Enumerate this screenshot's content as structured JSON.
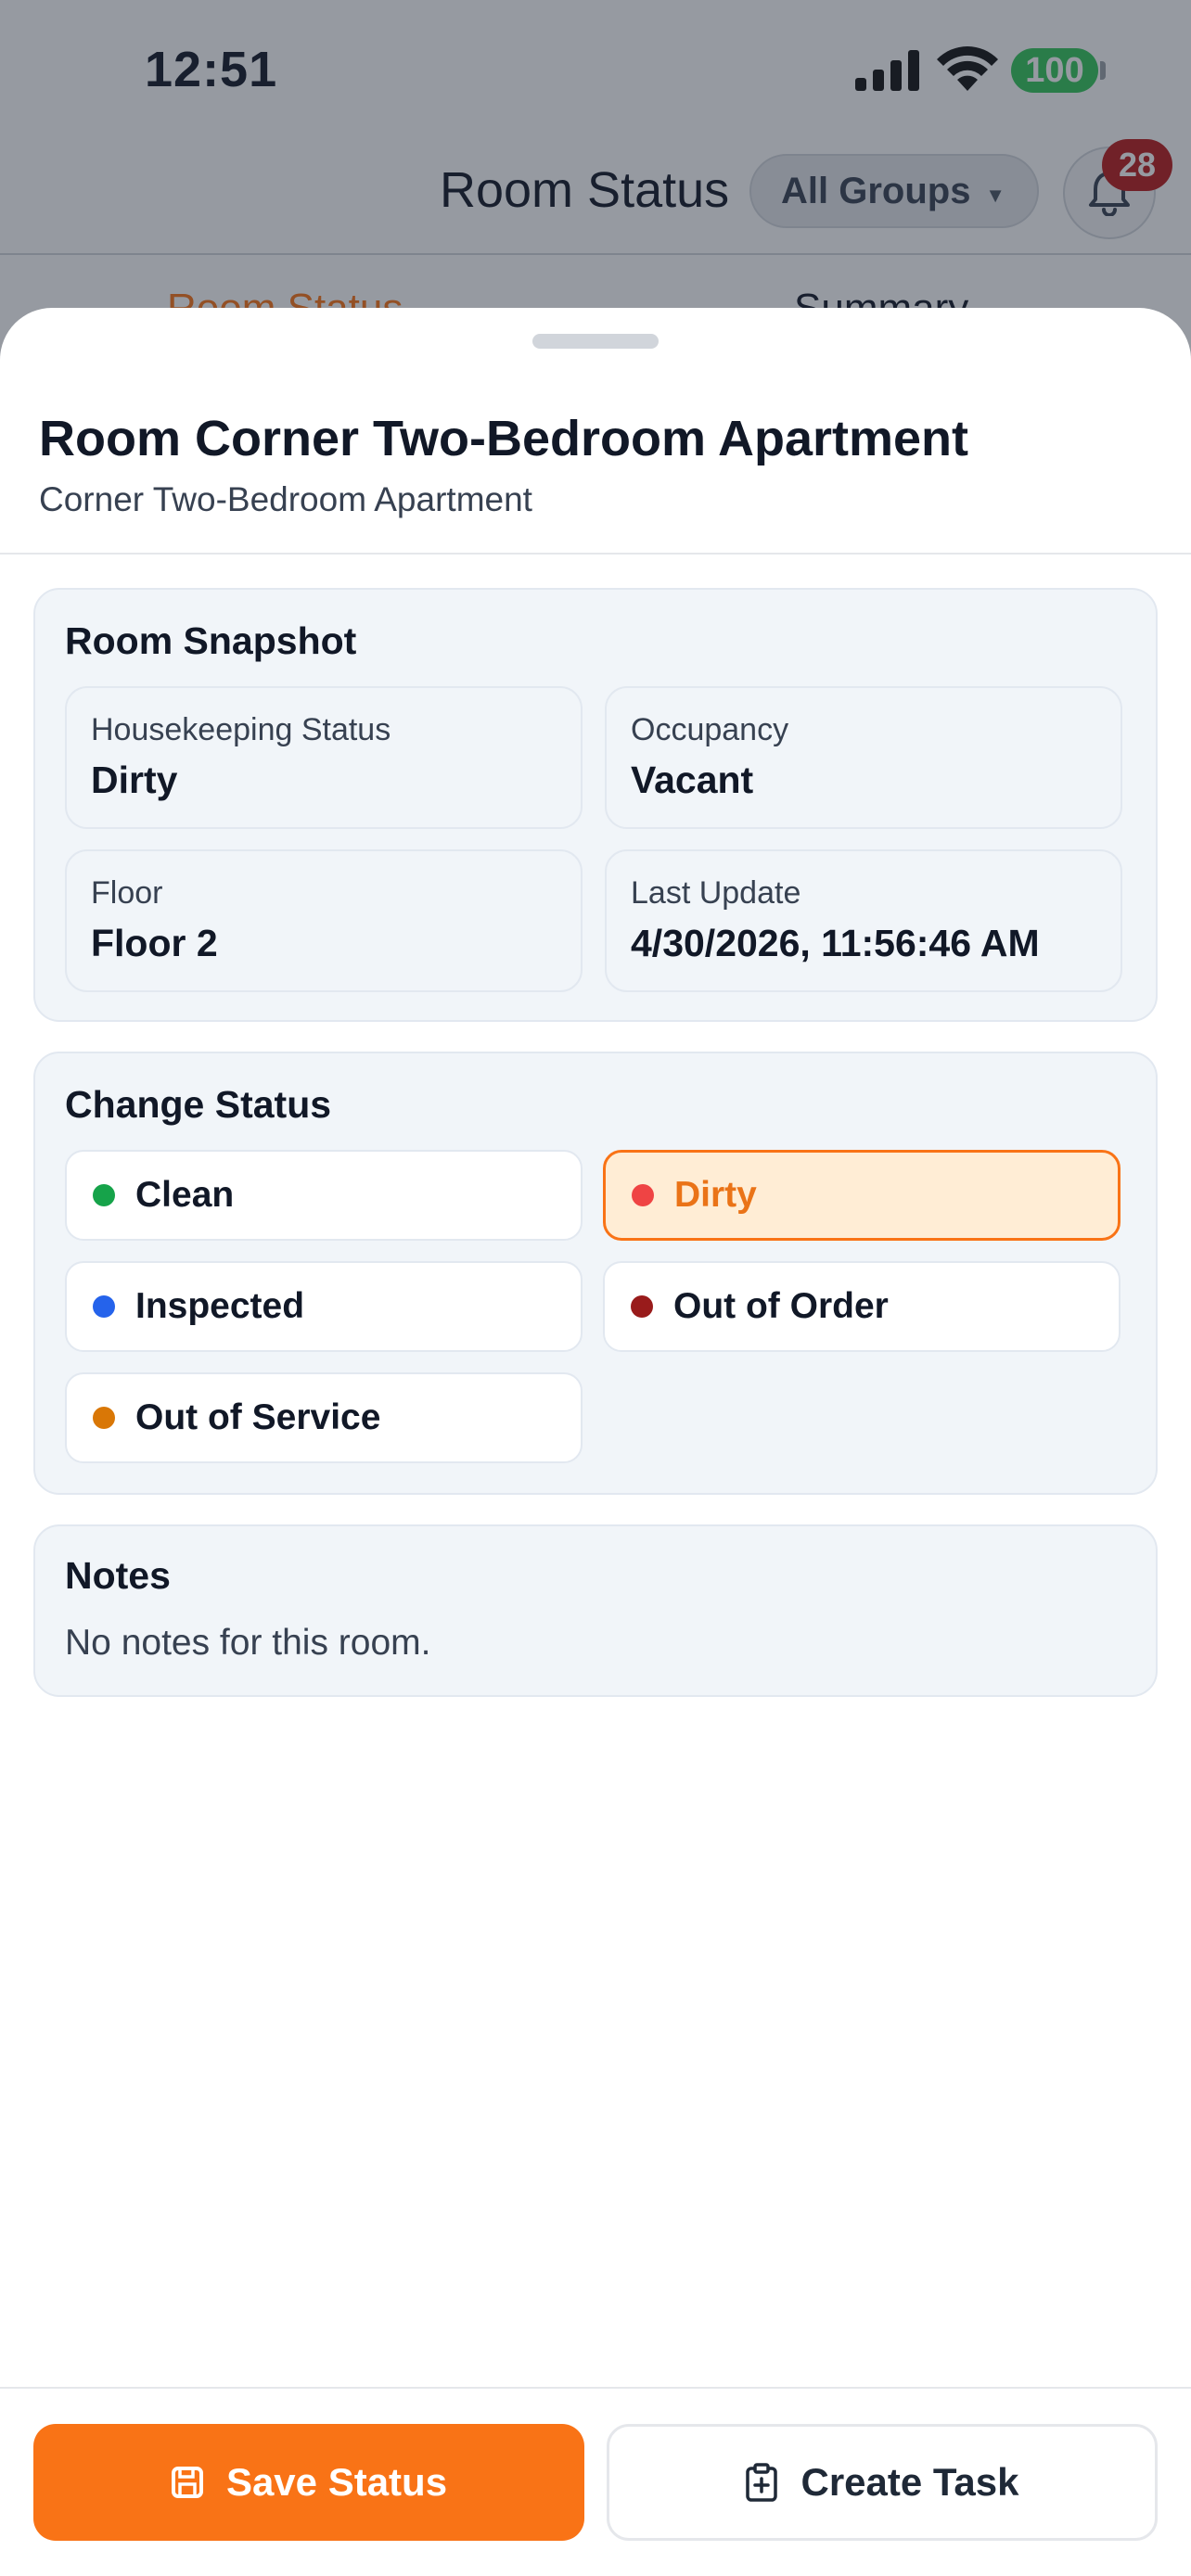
{
  "status_bar": {
    "time": "12:51",
    "battery": "100",
    "icons": [
      "cellular-signal-icon",
      "wifi-icon",
      "battery-icon"
    ]
  },
  "header": {
    "title": "Room Status",
    "group_filter": "All Groups",
    "notification_count": "28",
    "icons": [
      "chevron-down-icon",
      "bell-icon"
    ]
  },
  "tabs": [
    {
      "label": "Room Status",
      "active": true
    },
    {
      "label": "Summary",
      "active": false
    }
  ],
  "sheet": {
    "title": "Room Corner Two-Bedroom Apartment",
    "subtitle": "Corner Two-Bedroom Apartment",
    "snapshot": {
      "title": "Room Snapshot",
      "fields": [
        {
          "label": "Housekeeping Status",
          "value": "Dirty"
        },
        {
          "label": "Occupancy",
          "value": "Vacant"
        },
        {
          "label": "Floor",
          "value": "Floor 2"
        },
        {
          "label": "Last Update",
          "value": "4/30/2026, 11:56:46 AM"
        }
      ]
    },
    "change_status": {
      "title": "Change Status",
      "selected": "Dirty",
      "options": [
        {
          "label": "Clean",
          "color": "#16a34a"
        },
        {
          "label": "Dirty",
          "color": "#ef4444"
        },
        {
          "label": "Inspected",
          "color": "#2563eb"
        },
        {
          "label": "Out of Order",
          "color": "#991b1b"
        },
        {
          "label": "Out of Service",
          "color": "#d97706"
        }
      ]
    },
    "notes": {
      "title": "Notes",
      "text": "No notes for this room."
    }
  },
  "footer": {
    "save_label": "Save Status",
    "create_label": "Create Task",
    "icons": [
      "save-icon",
      "clipboard-plus-icon"
    ]
  },
  "colors": {
    "accent": "#f97316",
    "selected_bg": "#ffedd5",
    "card_bg": "#f1f5f9",
    "badge": "#b91c1c"
  }
}
